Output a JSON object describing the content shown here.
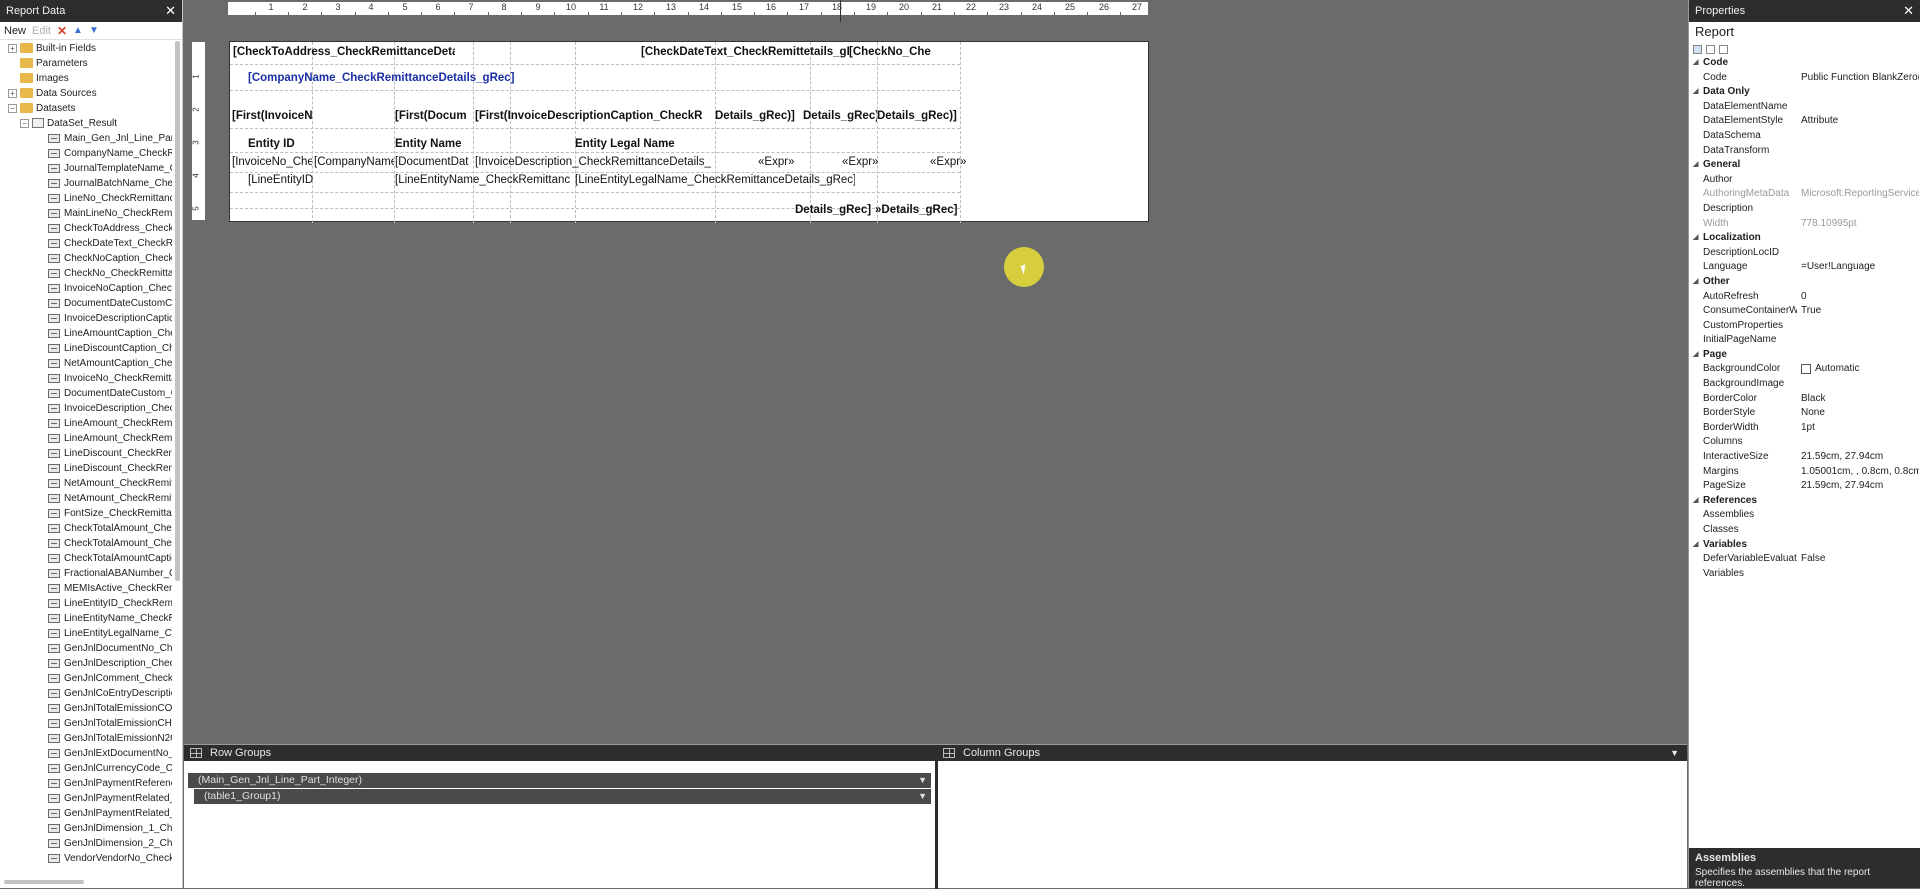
{
  "left_pane": {
    "title": "Report Data",
    "toolbar": {
      "new": "New",
      "edit": "Edit"
    },
    "tree": [
      {
        "label": "Built-in Fields",
        "kind": "folder",
        "level": 0,
        "expander": "+"
      },
      {
        "label": "Parameters",
        "kind": "folder",
        "level": 0,
        "expander": ""
      },
      {
        "label": "Images",
        "kind": "folder",
        "level": 0,
        "expander": ""
      },
      {
        "label": "Data Sources",
        "kind": "folder",
        "level": 0,
        "expander": "+"
      },
      {
        "label": "Datasets",
        "kind": "folder",
        "level": 0,
        "expander": "−"
      },
      {
        "label": "DataSet_Result",
        "kind": "dataset",
        "level": 1,
        "expander": "−"
      },
      {
        "label": "Main_Gen_Jnl_Line_Part_",
        "kind": "field",
        "level": 2
      },
      {
        "label": "CompanyName_CheckRe",
        "kind": "field",
        "level": 2
      },
      {
        "label": "JournalTemplateName_C",
        "kind": "field",
        "level": 2
      },
      {
        "label": "JournalBatchName_Chec",
        "kind": "field",
        "level": 2
      },
      {
        "label": "LineNo_CheckRemittanc",
        "kind": "field",
        "level": 2
      },
      {
        "label": "MainLineNo_CheckRemit",
        "kind": "field",
        "level": 2
      },
      {
        "label": "CheckToAddress_CheckR",
        "kind": "field",
        "level": 2
      },
      {
        "label": "CheckDateText_CheckRe",
        "kind": "field",
        "level": 2
      },
      {
        "label": "CheckNoCaption_CheckI",
        "kind": "field",
        "level": 2
      },
      {
        "label": "CheckNo_CheckRemittan",
        "kind": "field",
        "level": 2
      },
      {
        "label": "InvoiceNoCaption_Check",
        "kind": "field",
        "level": 2
      },
      {
        "label": "DocumentDateCustomCa",
        "kind": "field",
        "level": 2
      },
      {
        "label": "InvoiceDescriptionCaptic",
        "kind": "field",
        "level": 2
      },
      {
        "label": "LineAmountCaption_Che",
        "kind": "field",
        "level": 2
      },
      {
        "label": "LineDiscountCaption_Ch",
        "kind": "field",
        "level": 2
      },
      {
        "label": "NetAmountCaption_Chec",
        "kind": "field",
        "level": 2
      },
      {
        "label": "InvoiceNo_CheckRemitta",
        "kind": "field",
        "level": 2
      },
      {
        "label": "DocumentDateCustom_C",
        "kind": "field",
        "level": 2
      },
      {
        "label": "InvoiceDescription_Chec",
        "kind": "field",
        "level": 2
      },
      {
        "label": "LineAmount_CheckRemit",
        "kind": "field",
        "level": 2
      },
      {
        "label": "LineAmount_CheckRemit",
        "kind": "field",
        "level": 2
      },
      {
        "label": "LineDiscount_CheckRemi",
        "kind": "field",
        "level": 2
      },
      {
        "label": "LineDiscount_CheckRemi",
        "kind": "field",
        "level": 2
      },
      {
        "label": "NetAmount_CheckRemitt",
        "kind": "field",
        "level": 2
      },
      {
        "label": "NetAmount_CheckRemitt",
        "kind": "field",
        "level": 2
      },
      {
        "label": "FontSize_CheckRemittan",
        "kind": "field",
        "level": 2
      },
      {
        "label": "CheckTotalAmount_Chec",
        "kind": "field",
        "level": 2
      },
      {
        "label": "CheckTotalAmount_Chec",
        "kind": "field",
        "level": 2
      },
      {
        "label": "CheckTotalAmountCaptic",
        "kind": "field",
        "level": 2
      },
      {
        "label": "FractionalABANumber_C",
        "kind": "field",
        "level": 2
      },
      {
        "label": "MEMIsActive_CheckRemi",
        "kind": "field",
        "level": 2
      },
      {
        "label": "LineEntityID_CheckRemit",
        "kind": "field",
        "level": 2
      },
      {
        "label": "LineEntityName_CheckRe",
        "kind": "field",
        "level": 2
      },
      {
        "label": "LineEntityLegalName_Ch",
        "kind": "field",
        "level": 2
      },
      {
        "label": "GenJnlDocumentNo_Che",
        "kind": "field",
        "level": 2
      },
      {
        "label": "GenJnlDescription_Check",
        "kind": "field",
        "level": 2
      },
      {
        "label": "GenJnlComment_CheckR",
        "kind": "field",
        "level": 2
      },
      {
        "label": "GenJnlCoEntryDescriptio",
        "kind": "field",
        "level": 2
      },
      {
        "label": "GenJnlTotalEmissionCO2",
        "kind": "field",
        "level": 2
      },
      {
        "label": "GenJnlTotalEmissionCH4",
        "kind": "field",
        "level": 2
      },
      {
        "label": "GenJnlTotalEmissionN2C",
        "kind": "field",
        "level": 2
      },
      {
        "label": "GenJnlExtDocumentNo_C",
        "kind": "field",
        "level": 2
      },
      {
        "label": "GenJnlCurrencyCode_Ch",
        "kind": "field",
        "level": 2
      },
      {
        "label": "GenJnlPaymentReferenc",
        "kind": "field",
        "level": 2
      },
      {
        "label": "GenJnlPaymentRelated_1",
        "kind": "field",
        "level": 2
      },
      {
        "label": "GenJnlPaymentRelated_2",
        "kind": "field",
        "level": 2
      },
      {
        "label": "GenJnlDimension_1_Che",
        "kind": "field",
        "level": 2
      },
      {
        "label": "GenJnlDimension_2_Che",
        "kind": "field",
        "level": 2
      },
      {
        "label": "VendorVendorNo_Check",
        "kind": "field",
        "level": 2
      }
    ]
  },
  "ruler": {
    "top_ticks": [
      "1",
      "2",
      "3",
      "4",
      "5",
      "6",
      "7",
      "8",
      "9",
      "10",
      "11",
      "12",
      "13",
      "14",
      "15",
      "16",
      "17",
      "18",
      "19",
      "20",
      "21",
      "22",
      "23",
      "24",
      "25",
      "26",
      "27"
    ],
    "left_ticks": [
      "1",
      "2",
      "3",
      "4",
      "5"
    ]
  },
  "report_cells": [
    {
      "text": "[CheckToAddress_CheckRemittanceDetails_gR",
      "bold": true,
      "blue": false
    },
    {
      "text": "[CheckDateText_CheckRemittetails_gRec]",
      "bold": true,
      "blue": false
    },
    {
      "text": "[CheckNo_Che",
      "bold": true,
      "blue": false
    },
    {
      "text": "[CompanyName_CheckRemittanceDetails_gRec]",
      "bold": true,
      "blue": true
    },
    {
      "text": "[First(InvoiceN",
      "bold": true,
      "blue": false
    },
    {
      "text": "[First(Docum",
      "bold": true,
      "blue": false
    },
    {
      "text": "[First(InvoiceDescriptionCaption_CheckR",
      "bold": true,
      "blue": false
    },
    {
      "text": "Details_gRec)]",
      "bold": true,
      "blue": false
    },
    {
      "text": "Details_gRec)]",
      "bold": true,
      "blue": false
    },
    {
      "text": "Details_gRec)]",
      "bold": true,
      "blue": false
    },
    {
      "text": "Entity ID",
      "bold": true,
      "blue": false
    },
    {
      "text": "Entity Name",
      "bold": true,
      "blue": false
    },
    {
      "text": "Entity Legal Name",
      "bold": true,
      "blue": false
    },
    {
      "text": "[InvoiceNo_Che",
      "bold": false,
      "blue": false
    },
    {
      "text": "[CompanyName",
      "bold": false,
      "blue": false
    },
    {
      "text": "[DocumentDat",
      "bold": false,
      "blue": false
    },
    {
      "text": "[InvoiceDescription_CheckRemittanceDetails_",
      "bold": false,
      "blue": false
    },
    {
      "text": "«Expr»",
      "bold": false,
      "blue": false
    },
    {
      "text": "«Expr»",
      "bold": false,
      "blue": false
    },
    {
      "text": "«Expr»",
      "bold": false,
      "blue": false
    },
    {
      "text": "[LineEntityID",
      "bold": false,
      "blue": false
    },
    {
      "text": "[LineEntityName_CheckRemittanc",
      "bold": false,
      "blue": false
    },
    {
      "text": "[LineEntityLegalName_CheckRemittanceDetails_gRec]",
      "bold": false,
      "blue": false
    },
    {
      "text": "Details_gRec]",
      "bold": true,
      "blue": false
    },
    {
      "text": "»Details_gRec]",
      "bold": true,
      "blue": false
    }
  ],
  "groups": {
    "row_title": "Row Groups",
    "column_title": "Column Groups",
    "row_items": [
      "(Main_Gen_Jnl_Line_Part_Integer)",
      "(table1_Group1)"
    ]
  },
  "properties": {
    "title": "Properties",
    "object": "Report",
    "rows": [
      {
        "type": "cat",
        "name": "Code"
      },
      {
        "type": "prop",
        "name": "Code",
        "value": "Public Function BlankZero(B"
      },
      {
        "type": "cat",
        "name": "Data Only"
      },
      {
        "type": "prop",
        "name": "DataElementName",
        "value": ""
      },
      {
        "type": "prop",
        "name": "DataElementStyle",
        "value": "Attribute"
      },
      {
        "type": "prop",
        "name": "DataSchema",
        "value": ""
      },
      {
        "type": "prop",
        "name": "DataTransform",
        "value": ""
      },
      {
        "type": "cat",
        "name": "General"
      },
      {
        "type": "prop",
        "name": "Author",
        "value": ""
      },
      {
        "type": "prop",
        "name": "AuthoringMetaData",
        "value": "Microsoft.ReportingServices.",
        "gray": true
      },
      {
        "type": "prop",
        "name": "Description",
        "value": ""
      },
      {
        "type": "prop",
        "name": "Width",
        "value": "778.10995pt",
        "gray": true
      },
      {
        "type": "cat",
        "name": "Localization"
      },
      {
        "type": "prop",
        "name": "DescriptionLocID",
        "value": ""
      },
      {
        "type": "prop",
        "name": "Language",
        "value": "=User!Language"
      },
      {
        "type": "cat",
        "name": "Other"
      },
      {
        "type": "prop",
        "name": "AutoRefresh",
        "value": "0"
      },
      {
        "type": "prop",
        "name": "ConsumeContainerW",
        "value": "True"
      },
      {
        "type": "prop",
        "name": "CustomProperties",
        "value": ""
      },
      {
        "type": "prop",
        "name": "InitialPageName",
        "value": ""
      },
      {
        "type": "cat",
        "name": "Page"
      },
      {
        "type": "prop",
        "name": "BackgroundColor",
        "value": "Automatic",
        "swatch": true
      },
      {
        "type": "prop",
        "name": "BackgroundImage",
        "value": ""
      },
      {
        "type": "prop",
        "name": "BorderColor",
        "value": "Black"
      },
      {
        "type": "prop",
        "name": "BorderStyle",
        "value": "None"
      },
      {
        "type": "prop",
        "name": "BorderWidth",
        "value": "1pt"
      },
      {
        "type": "prop",
        "name": "Columns",
        "value": ""
      },
      {
        "type": "prop",
        "name": "InteractiveSize",
        "value": "21.59cm, 27.94cm"
      },
      {
        "type": "prop",
        "name": "Margins",
        "value": "1.05001cm, , 0.8cm, 0.8cm"
      },
      {
        "type": "prop",
        "name": "PageSize",
        "value": "21.59cm, 27.94cm"
      },
      {
        "type": "cat",
        "name": "References"
      },
      {
        "type": "prop",
        "name": "Assemblies",
        "value": ""
      },
      {
        "type": "prop",
        "name": "Classes",
        "value": ""
      },
      {
        "type": "cat",
        "name": "Variables"
      },
      {
        "type": "prop",
        "name": "DeferVariableEvaluati",
        "value": "False"
      },
      {
        "type": "prop",
        "name": "Variables",
        "value": ""
      }
    ],
    "description_title": "Assemblies",
    "description_text": "Specifies the assemblies that the report references."
  },
  "colors": {
    "dark_chrome": "#2d2d30",
    "canvas": "#6b6b6b",
    "cursor_highlight": "#e1d73c",
    "link_blue": "#1a2fa3"
  }
}
